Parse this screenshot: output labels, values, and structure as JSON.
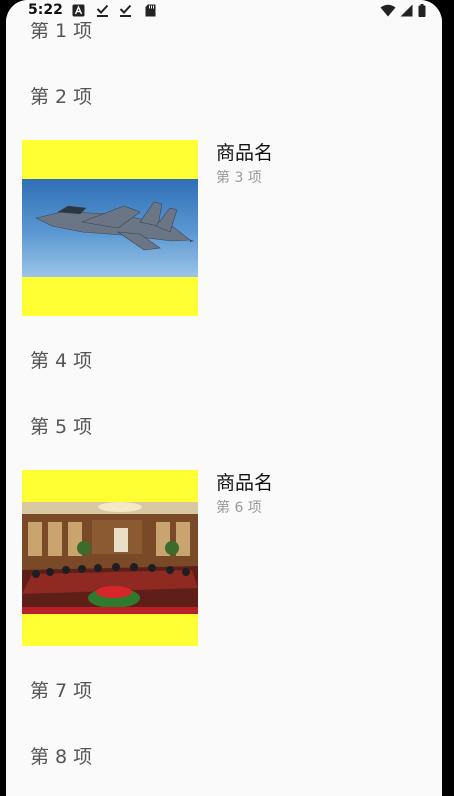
{
  "statusbar": {
    "time": "5:22",
    "icons": [
      "a-icon",
      "check-download-icon",
      "check-download-icon",
      "sd-card-icon",
      "wifi-icon",
      "signal-icon",
      "battery-icon"
    ]
  },
  "list": {
    "items": [
      {
        "label": "第 1 项"
      },
      {
        "label": "第 2 项"
      },
      {
        "title": "商品名",
        "subtitle": "第 3 项"
      },
      {
        "label": "第 4 项"
      },
      {
        "label": "第 5 项"
      },
      {
        "title": "商品名",
        "subtitle": "第 6 项"
      },
      {
        "label": "第 7 项"
      },
      {
        "label": "第 8 项"
      }
    ]
  },
  "colors": {
    "background": "#fafafa",
    "image_placeholder": "#ffff33",
    "primary_text": "#111111",
    "secondary_text": "#9a9a9a",
    "list_text": "#555555"
  }
}
